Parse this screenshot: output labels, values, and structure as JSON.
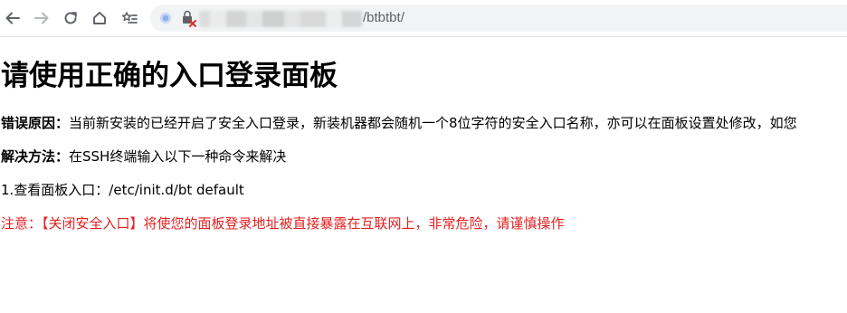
{
  "browser": {
    "url_visible_suffix": "/btbtbt/",
    "icons": [
      "back-arrow-icon",
      "forward-arrow-icon",
      "reload-icon",
      "home-icon",
      "reading-list-icon",
      "site-info-icon",
      "insecure-lock-icon"
    ]
  },
  "page": {
    "title": "请使用正确的入口登录面板",
    "error_label": "错误原因：",
    "error_text": "当前新安装的已经开启了安全入口登录，新装机器都会随机一个8位字符的安全入口名称，亦可以在面板设置处修改，如您",
    "solution_label": "解决方法：",
    "solution_text": "在SSH终端输入以下一种命令来解决",
    "command_line": "1.查看面板入口：/etc/init.d/bt default",
    "warning": "注意：【关闭安全入口】将使您的面板登录地址被直接暴露在互联网上，非常危险，请谨慎操作"
  },
  "colors": {
    "warning": "#e32020",
    "toolbar_icon": "#5f6368",
    "omnibox_bg": "#f1f3f4"
  }
}
